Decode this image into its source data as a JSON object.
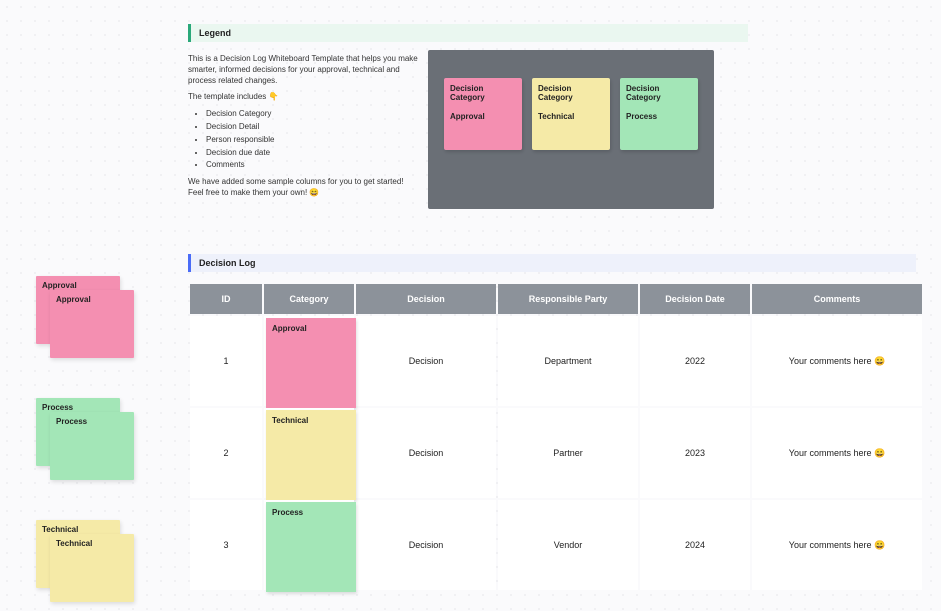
{
  "legend": {
    "title": "Legend",
    "intro": "This is a Decision Log Whiteboard Template that helps you make smarter, informed decisions for your approval, technical and process related changes.",
    "includes_label": "The template includes 👇",
    "bullets": [
      "Decision Category",
      "Decision Detail",
      "Person responsible",
      "Decision due date",
      "Comments"
    ],
    "outro": "We have added some sample columns for you to get started! Feel free to make them your own! 😄",
    "cards": {
      "title_label": "Decision Category",
      "approval": "Approval",
      "technical": "Technical",
      "process": "Process"
    }
  },
  "sidebar": {
    "approval": "Approval",
    "process": "Process",
    "technical": "Technical"
  },
  "log": {
    "title": "Decision Log",
    "headers": {
      "id": "ID",
      "category": "Category",
      "decision": "Decision",
      "responsible": "Responsible Party",
      "date": "Decision Date",
      "comments": "Comments"
    },
    "rows": [
      {
        "id": "1",
        "category": "Approval",
        "cat_color": "pink",
        "decision": "Decision",
        "responsible": "Department",
        "date": "2022",
        "comments": "Your comments here 😀"
      },
      {
        "id": "2",
        "category": "Technical",
        "cat_color": "yellow",
        "decision": "Decision",
        "responsible": "Partner",
        "date": "2023",
        "comments": "Your comments here 😀"
      },
      {
        "id": "3",
        "category": "Process",
        "cat_color": "green",
        "decision": "Decision",
        "responsible": "Vendor",
        "date": "2024",
        "comments": "Your comments here 😀"
      }
    ]
  }
}
